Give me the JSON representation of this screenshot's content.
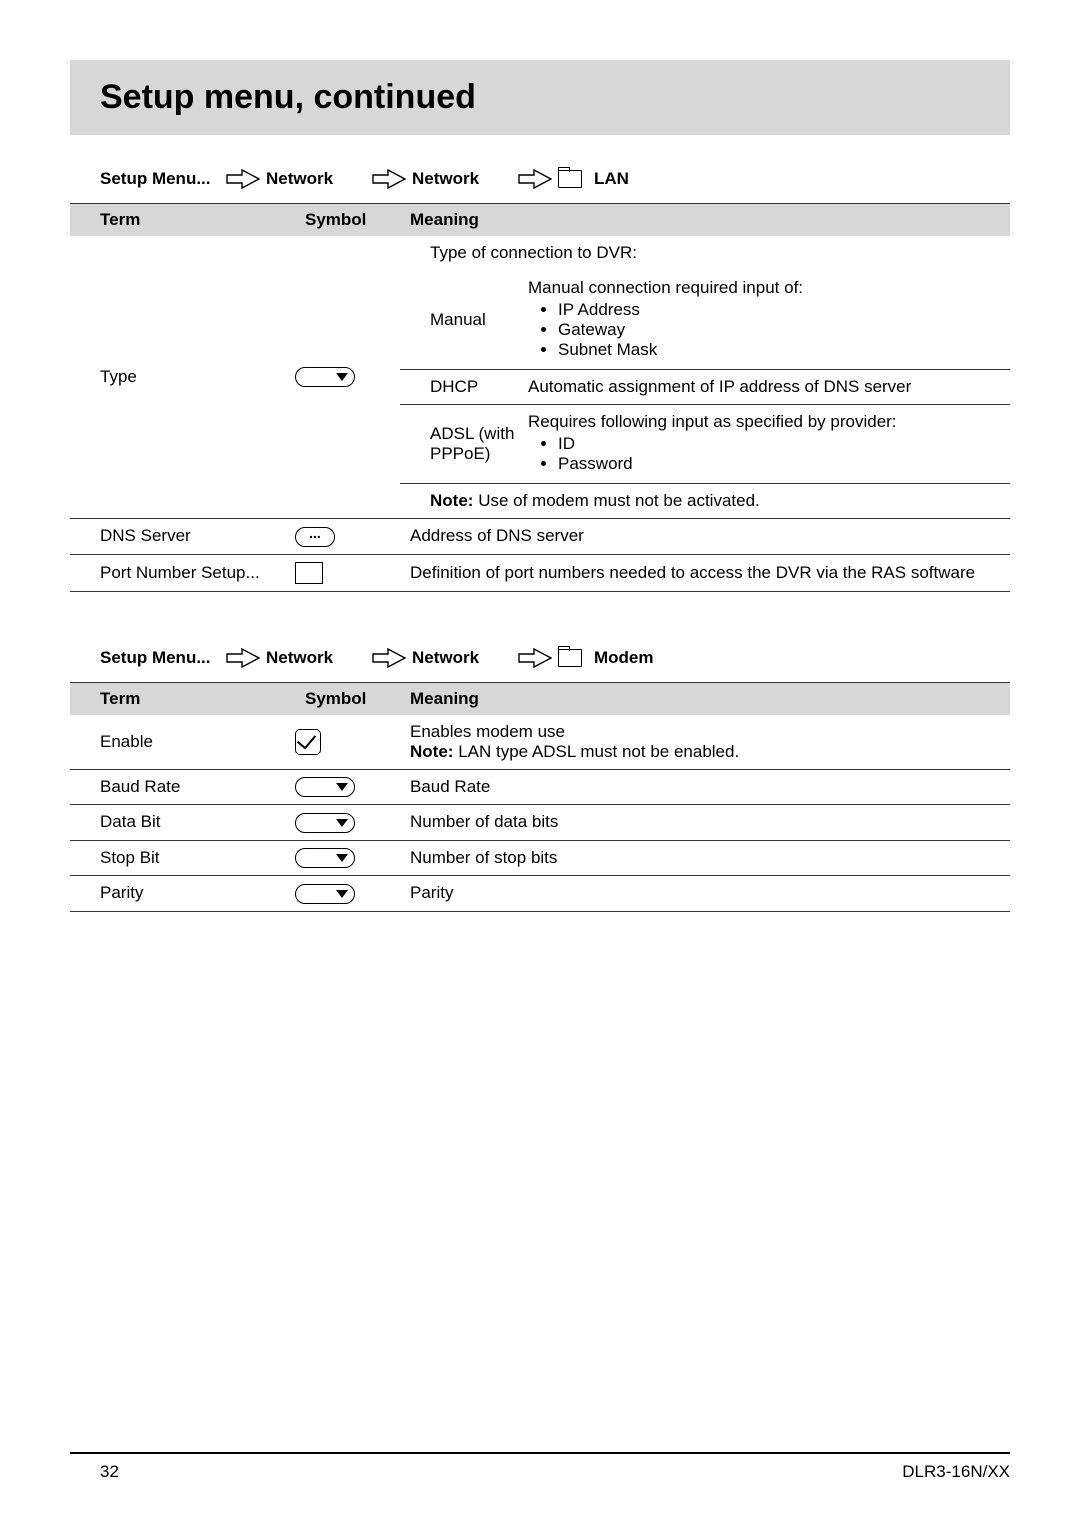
{
  "page_title": "Setup menu, continued",
  "footer": {
    "page": "32",
    "model": "DLR3-16N/XX"
  },
  "breadcrumb1": {
    "items": [
      "Setup Menu...",
      "Network",
      "Network",
      "LAN"
    ]
  },
  "breadcrumb2": {
    "items": [
      "Setup Menu...",
      "Network",
      "Network",
      "Modem"
    ]
  },
  "table_headers": {
    "term": "Term",
    "symbol": "Symbol",
    "meaning": "Meaning"
  },
  "table1": {
    "rows": [
      {
        "term": "Type",
        "symbol_kind": "dropdown",
        "meaning": {
          "lead": "Type of connection to DVR:",
          "options": [
            {
              "name": "Manual",
              "desc": "Manual connection required input of:",
              "bullets": [
                "IP Address",
                "Gateway",
                "Subnet Mask"
              ]
            },
            {
              "name": "DHCP",
              "desc": "Automatic assignment of IP address of DNS server"
            },
            {
              "name": "ADSL (with PPPoE)",
              "desc": "Requires following input as specified by provider:",
              "bullets": [
                "ID",
                "Password"
              ]
            }
          ],
          "note_label": "Note:",
          "note": "Use of modem must not be activated."
        }
      },
      {
        "term": "DNS Server",
        "symbol_kind": "ellipsis",
        "meaning_text": "Address of DNS server"
      },
      {
        "term": "Port Number Setup...",
        "symbol_kind": "rect",
        "meaning_text": "Definition of port numbers needed to access the DVR via the RAS software"
      }
    ]
  },
  "table2": {
    "rows": [
      {
        "term": "Enable",
        "symbol_kind": "checkbox",
        "meaning_text": "Enables modem use",
        "note_label": "Note:",
        "note": "LAN type ADSL must not be enabled."
      },
      {
        "term": "Baud Rate",
        "symbol_kind": "dropdown",
        "meaning_text": "Baud Rate"
      },
      {
        "term": "Data Bit",
        "symbol_kind": "dropdown",
        "meaning_text": "Number of data bits"
      },
      {
        "term": "Stop Bit",
        "symbol_kind": "dropdown",
        "meaning_text": "Number of stop bits"
      },
      {
        "term": "Parity",
        "symbol_kind": "dropdown",
        "meaning_text": "Parity"
      }
    ]
  }
}
